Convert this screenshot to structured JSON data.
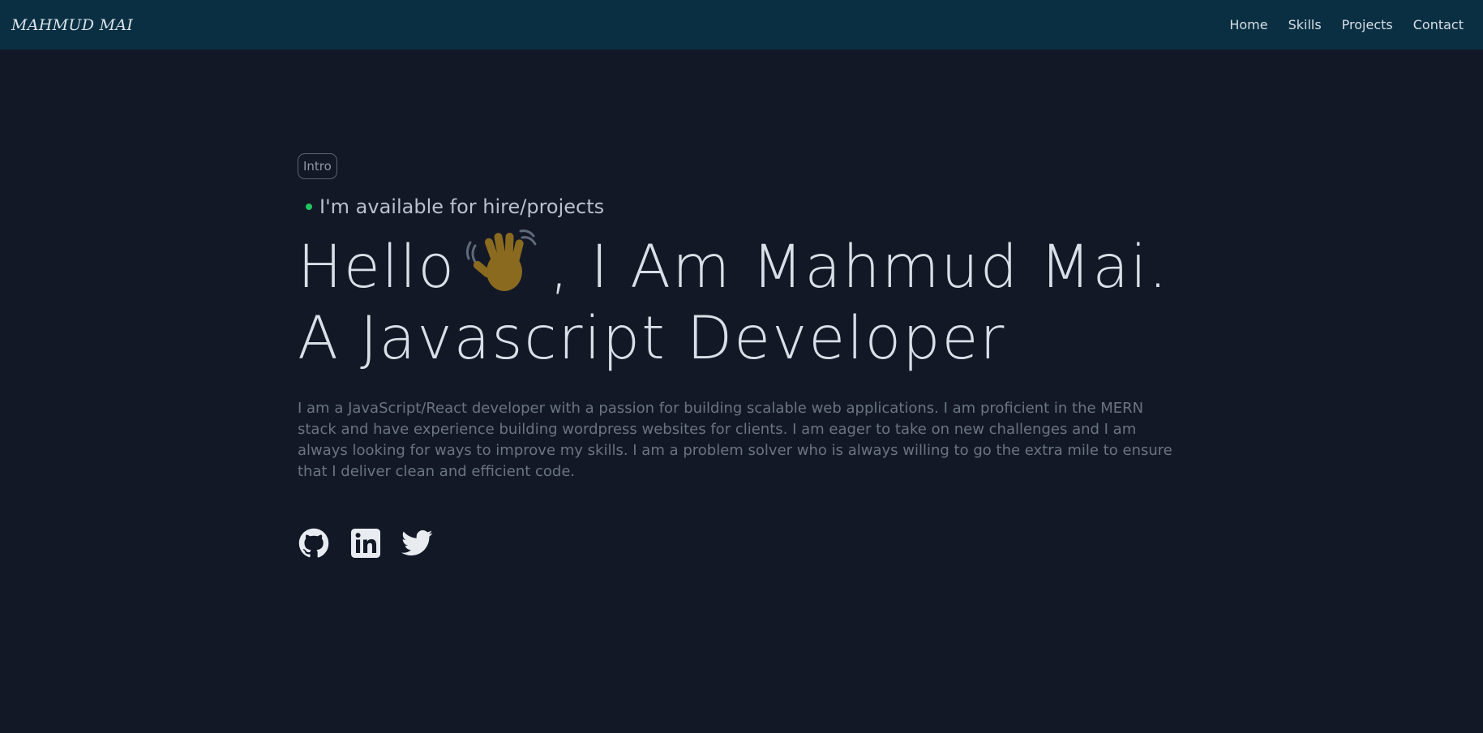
{
  "nav": {
    "logo": "MAHMUD MAI",
    "links": [
      "Home",
      "Skills",
      "Projects",
      "Contact"
    ]
  },
  "hero": {
    "badge": "Intro",
    "availability": "I'm available for hire/projects",
    "headline_pre": "Hello",
    "headline_post": ", I Am Mahmud Mai. A Javascript Developer",
    "bio": "I am a JavaScript/React developer with a passion for building scalable web applications. I am proficient in the MERN stack and have experience building wordpress websites for clients. I am eager to take on new challenges and I am always looking for ways to improve my skills. I am a problem solver who is always willing to go the extra mile to ensure that I deliver clean and efficient code.",
    "wave_icon": "waving-hand-icon"
  },
  "socials": [
    {
      "name": "GitHub",
      "icon": "github-icon"
    },
    {
      "name": "LinkedIn",
      "icon": "linkedin-icon"
    },
    {
      "name": "Twitter",
      "icon": "twitter-icon"
    }
  ],
  "colors": {
    "background": "#121826",
    "navbar": "#0a2f42",
    "status": "#22c55e"
  }
}
